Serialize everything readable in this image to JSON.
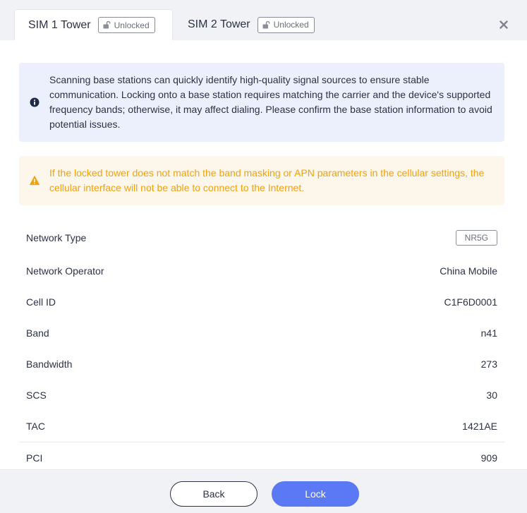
{
  "tabs": [
    {
      "label": "SIM 1 Tower",
      "status": "Unlocked",
      "active": true
    },
    {
      "label": "SIM 2 Tower",
      "status": "Unlocked",
      "active": false
    }
  ],
  "info_alert": {
    "text": "Scanning base stations can quickly identify high-quality signal sources to ensure stable communication. Locking onto a base station requires matching the carrier and the device's supported frequency bands; otherwise, it may affect dialing. Please confirm the base station information to avoid potential issues."
  },
  "warning_alert": {
    "text": "If the locked tower does not match the band masking or APN parameters in the cellular settings, the cellular interface will not be able to connect to the Internet."
  },
  "details": [
    {
      "label": "Network Type",
      "value": "NR5G"
    },
    {
      "label": "Network Operator",
      "value": "China Mobile"
    },
    {
      "label": "Cell ID",
      "value": "C1F6D0001"
    },
    {
      "label": "Band",
      "value": "n41"
    },
    {
      "label": "Bandwidth",
      "value": "273"
    },
    {
      "label": "SCS",
      "value": "30"
    },
    {
      "label": "TAC",
      "value": "1421AE"
    },
    {
      "label": "PCI",
      "value": "909"
    }
  ],
  "footer": {
    "back_label": "Back",
    "lock_label": "Lock"
  },
  "colors": {
    "primary": "#5b78f5",
    "info_bg": "#ecf0fc",
    "warning_bg": "#fdf6ea",
    "warning_text": "#f0a20f"
  }
}
